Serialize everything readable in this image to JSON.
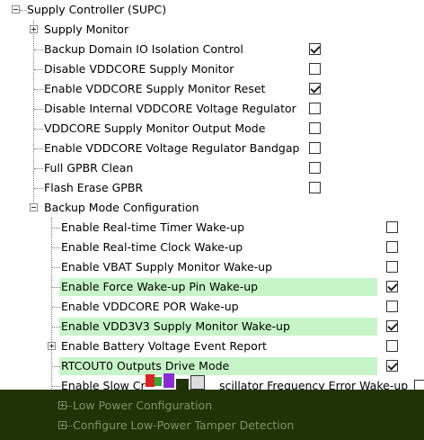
{
  "tree": {
    "root": {
      "label": "Supply Controller (SUPC)"
    },
    "supply_monitor": {
      "label": "Supply Monitor"
    },
    "items": [
      {
        "label": "Backup Domain IO Isolation Control",
        "checked": true
      },
      {
        "label": "Disable VDDCORE Supply Monitor",
        "checked": false
      },
      {
        "label": "Enable VDDCORE Supply Monitor Reset",
        "checked": true
      },
      {
        "label": "Disable Internal VDDCORE Voltage Regulator",
        "checked": false
      },
      {
        "label": "VDDCORE Supply Monitor Output Mode",
        "checked": false
      },
      {
        "label": "Enable VDDCORE Voltage Regulator Bandgap",
        "checked": false
      },
      {
        "label": "Full GPBR Clean",
        "checked": false
      },
      {
        "label": "Flash Erase GPBR",
        "checked": false
      }
    ],
    "backup_mode": {
      "label": "Backup Mode Configuration",
      "items": [
        {
          "label": "Enable Real-time Timer Wake-up",
          "checked": false,
          "highlighted": false
        },
        {
          "label": "Enable Real-time Clock Wake-up",
          "checked": false,
          "highlighted": false
        },
        {
          "label": "Enable VBAT Supply Monitor Wake-up",
          "checked": false,
          "highlighted": false
        },
        {
          "label": "Enable Force Wake-up Pin Wake-up",
          "checked": true,
          "highlighted": true
        },
        {
          "label": "Enable VDDCORE POR Wake-up",
          "checked": false,
          "highlighted": false
        },
        {
          "label": "Enable VDD3V3 Supply Monitor Wake-up",
          "checked": true,
          "highlighted": true
        },
        {
          "label": "Enable Battery Voltage Event Report",
          "checked": false,
          "highlighted": false,
          "expandable": true
        },
        {
          "label": "RTCOUT0 Outputs Drive Mode",
          "checked": true,
          "highlighted": true
        },
        {
          "label": "Enable Slow Cr",
          "label_tail": "scillator Frequency Error Wake-up",
          "checked": false,
          "highlighted": false
        }
      ]
    },
    "bottom_items": [
      {
        "label": "Low Power Configuration"
      },
      {
        "label": "Configure Low-Power Tamper Detection"
      }
    ]
  },
  "colors": {
    "highlight": "#c8f5c8",
    "overlay_bg": "#1f3406",
    "overlay_text": "#7d9361"
  }
}
